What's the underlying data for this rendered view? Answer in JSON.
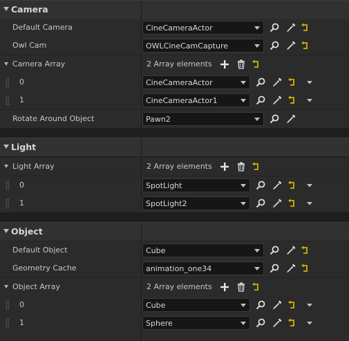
{
  "sections": {
    "camera": {
      "title": "Camera",
      "default_camera": {
        "label": "Default Camera",
        "value": "CineCameraActor"
      },
      "owl_cam": {
        "label": "Owl Cam",
        "value": "OWLCineCamCapture"
      },
      "camera_array": {
        "label": "Camera Array",
        "count": "2 Array elements",
        "elements": [
          {
            "index": "0",
            "value": "CineCameraActor"
          },
          {
            "index": "1",
            "value": "CineCameraActor1"
          }
        ]
      },
      "rotate_around_object": {
        "label": "Rotate Around Object",
        "value": "Pawn2"
      }
    },
    "light": {
      "title": "Light",
      "light_array": {
        "label": "Light Array",
        "count": "2 Array elements",
        "elements": [
          {
            "index": "0",
            "value": "SpotLight"
          },
          {
            "index": "1",
            "value": "SpotLight2"
          }
        ]
      }
    },
    "object": {
      "title": "Object",
      "default_object": {
        "label": "Default Object",
        "value": "Cube"
      },
      "geometry_cache": {
        "label": "Geometry Cache",
        "value": "animation_one34"
      },
      "object_array": {
        "label": "Object Array",
        "count": "2 Array elements",
        "elements": [
          {
            "index": "0",
            "value": "Cube"
          },
          {
            "index": "1",
            "value": "Sphere"
          }
        ]
      }
    }
  },
  "icons": {
    "browse": "magnifier-icon",
    "pick": "eyedropper-icon",
    "reset": "reset-arrow-icon",
    "add": "plus-icon",
    "delete": "trash-icon",
    "more": "chevron-down-icon"
  },
  "colors": {
    "reset_icon": "#d4b300",
    "icon_white": "#e0e0e0"
  }
}
